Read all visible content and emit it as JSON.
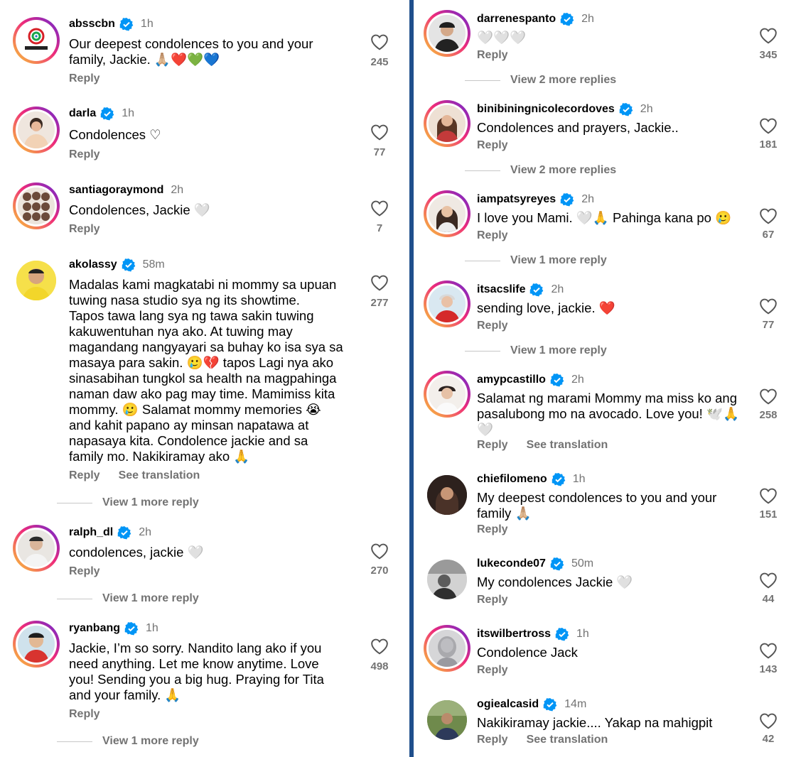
{
  "left": {
    "comments": [
      {
        "username": "absscbn",
        "time": "1h",
        "text": "Our deepest condolences to you and your\nfamily, Jackie. 🙏🏼❤️💚💙",
        "reply": "Reply",
        "likes": "245"
      },
      {
        "username": "darla",
        "time": "1h",
        "text": "Condolences ♡",
        "reply": "Reply",
        "likes": "77"
      },
      {
        "username": "santiagoraymond",
        "time": "2h",
        "text": "Condolences, Jackie 🤍",
        "reply": "Reply",
        "likes": "7"
      },
      {
        "username": "akolassy",
        "time": "58m",
        "text": "Madalas kami magkatabi ni mommy sa upuan\ntuwing nasa studio sya ng its showtime.\nTapos tawa lang sya ng tawa sakin tuwing\nkakuwentuhan nya ako. At tuwing may\nmagandang nangyayari sa buhay ko isa sya sa\nmasaya para sakin. 🥲💔 tapos Lagi nya ako\nsinasabihan tungkol sa health na magpahinga\nnaman daw ako pag may time. Mamimiss kita\nmommy. 🥲 Salamat mommy memories 😭\nand  kahit papano  ay minsan napatawa at\nnapasaya kita.  Condolence jackie and sa\nfamily mo. Nakikiramay ako 🙏",
        "reply": "Reply",
        "translation": "See translation",
        "likes": "277",
        "more": "View 1 more reply"
      },
      {
        "username": "ralph_dl",
        "time": "2h",
        "text": "condolences, jackie 🤍",
        "reply": "Reply",
        "likes": "270",
        "more": "View 1 more reply"
      },
      {
        "username": "ryanbang",
        "time": "1h",
        "text": "Jackie, I’m so sorry. Nandito lang ako if you\nneed anything. Let me know anytime. Love\nyou! Sending you a big hug. Praying for Tita\nand your family. 🙏",
        "reply": "Reply",
        "likes": "498",
        "more": "View 1 more reply"
      }
    ]
  },
  "right": {
    "comments": [
      {
        "username": "darrenespanto",
        "time": "2h",
        "text": "🤍🤍🤍",
        "reply": "Reply",
        "likes": "345",
        "more": "View 2 more replies"
      },
      {
        "username": "binibiningnicolecordoves",
        "time": "2h",
        "text": "Condolences and prayers, Jackie..",
        "reply": "Reply",
        "likes": "181",
        "more": "View 2 more replies"
      },
      {
        "username": "iampatsyreyes",
        "time": "2h",
        "text": "I love you Mami. 🤍🙏 Pahinga kana po 🥲",
        "reply": "Reply",
        "likes": "67",
        "more": "View 1 more reply"
      },
      {
        "username": "itsacslife",
        "time": "2h",
        "text": "sending love, jackie. ❤️",
        "reply": "Reply",
        "likes": "77",
        "more": "View 1 more reply"
      },
      {
        "username": "amypcastillo",
        "time": "2h",
        "text": "Salamat ng marami Mommy ma miss ko ang\npasalubong mo na avocado. Love you! 🕊️🙏\n🤍",
        "reply": "Reply",
        "translation": "See translation",
        "likes": "258"
      },
      {
        "username": "chiefilomeno",
        "time": "1h",
        "text": "My deepest condolences to you and your\nfamily 🙏🏼",
        "reply": "Reply",
        "likes": "151"
      },
      {
        "username": "lukeconde07",
        "time": "50m",
        "text": "My condolences Jackie 🤍",
        "reply": "Reply",
        "likes": "44"
      },
      {
        "username": "itswilbertross",
        "time": "1h",
        "text": "Condolence Jack",
        "reply": "Reply",
        "likes": "143"
      },
      {
        "username": "ogiealcasid",
        "time": "14m",
        "text": "Nakikiramay jackie.... Yakap na mahigpit",
        "reply": "Reply",
        "translation": "See translation",
        "likes": "42"
      }
    ]
  },
  "colors": {
    "verified": "#0095f6",
    "muted": "#737373",
    "divider": "#1f4f8c"
  }
}
